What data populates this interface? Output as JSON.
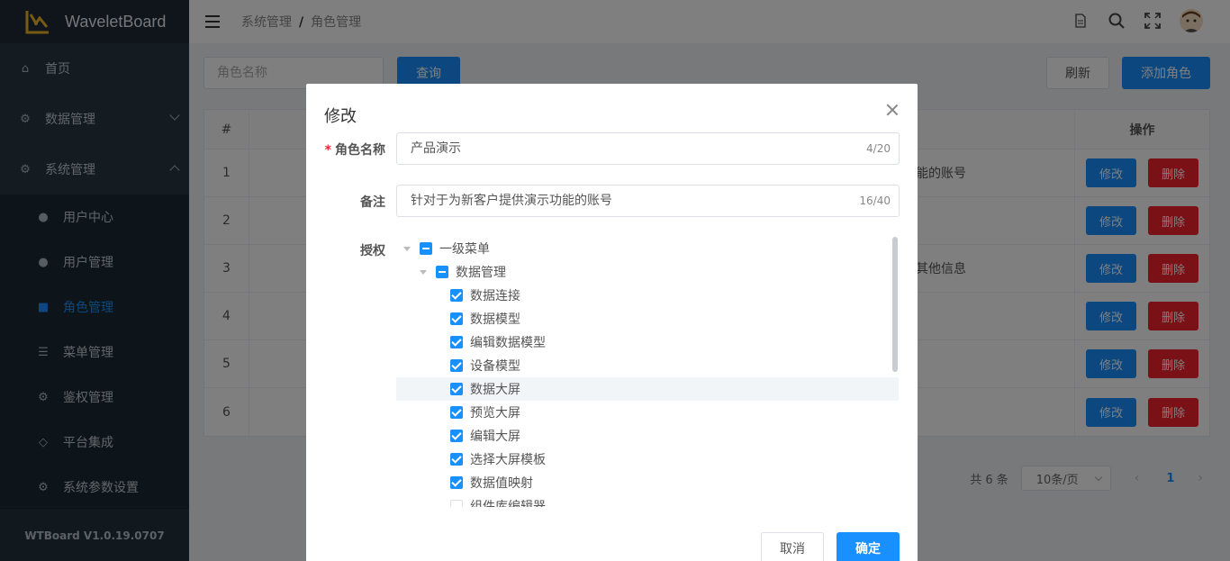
{
  "app": {
    "title": "WaveletBoard",
    "version": "WTBoard V1.0.19.0707"
  },
  "sidebar": {
    "items": [
      {
        "label": "首页",
        "icon": "home-icon"
      },
      {
        "label": "数据管理",
        "icon": "gear-icon"
      },
      {
        "label": "系统管理",
        "icon": "gear-icon"
      }
    ],
    "sub": [
      {
        "label": "用户中心",
        "icon": "user-icon"
      },
      {
        "label": "用户管理",
        "icon": "user-icon"
      },
      {
        "label": "角色管理",
        "icon": "lock-icon"
      },
      {
        "label": "菜单管理",
        "icon": "list-icon"
      },
      {
        "label": "鉴权管理",
        "icon": "gear-icon"
      },
      {
        "label": "平台集成",
        "icon": "cube-icon"
      },
      {
        "label": "系统参数设置",
        "icon": "gear-icon"
      }
    ]
  },
  "header": {
    "crumb1": "系统管理",
    "sep": "/",
    "crumb2": "角色管理"
  },
  "toolbar": {
    "search_placeholder": "角色名称",
    "query": "查询",
    "refresh": "刷新",
    "add": "添加角色"
  },
  "table": {
    "head_num": "#",
    "head_ops": "操作",
    "rows": [
      {
        "num": "1",
        "desc": "能的账号"
      },
      {
        "num": "2",
        "desc": ""
      },
      {
        "num": "3",
        "desc": "其他信息"
      },
      {
        "num": "4",
        "desc": ""
      },
      {
        "num": "5",
        "desc": ""
      },
      {
        "num": "6",
        "desc": ""
      }
    ],
    "edit": "修改",
    "delete": "删除"
  },
  "pagination": {
    "total": "共 6 条",
    "size": "10条/页",
    "prev": "‹",
    "page": "1",
    "next": "›"
  },
  "modal": {
    "title": "修改",
    "name_label": "角色名称",
    "name_value": "产品演示",
    "name_count": "4/20",
    "remark_label": "备注",
    "remark_value": "针对于为新客户提供演示功能的账号",
    "remark_count": "16/40",
    "auth_label": "授权",
    "tree": [
      {
        "label": "一级菜单",
        "state": "half"
      },
      {
        "label": "数据管理",
        "state": "half"
      },
      {
        "label": "数据连接",
        "state": "checked"
      },
      {
        "label": "数据模型",
        "state": "checked"
      },
      {
        "label": "编辑数据模型",
        "state": "checked"
      },
      {
        "label": "设备模型",
        "state": "checked"
      },
      {
        "label": "数据大屏",
        "state": "checked"
      },
      {
        "label": "预览大屏",
        "state": "checked"
      },
      {
        "label": "编辑大屏",
        "state": "checked"
      },
      {
        "label": "选择大屏模板",
        "state": "checked"
      },
      {
        "label": "数据值映射",
        "state": "checked"
      },
      {
        "label": "组件库编辑器",
        "state": "unchecked"
      }
    ],
    "cancel": "取消",
    "confirm": "确定"
  },
  "colors": {
    "primary": "#1890ff",
    "danger": "#f5222d",
    "sidebar": "#283845"
  }
}
